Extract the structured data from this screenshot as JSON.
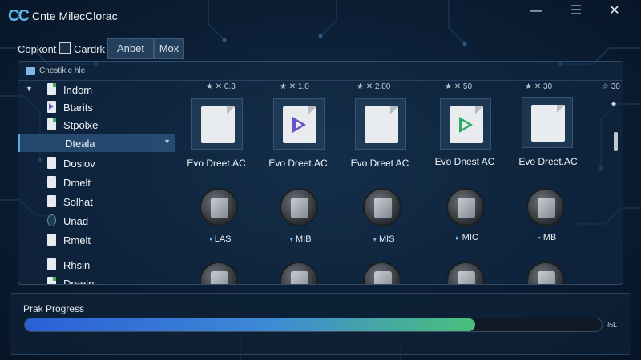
{
  "window": {
    "logo": "CC",
    "title": "Cnte MilecClorac",
    "minimize_icon": "minimize-icon",
    "maximize_icon": "maximize-icon",
    "close_icon": "close-icon"
  },
  "toolbar": {
    "label": "Copkont",
    "checkbox_label": "Cardrk",
    "tabs": [
      "Anbet",
      "Mox"
    ]
  },
  "browser": {
    "title": "Cnestikie hle"
  },
  "sidebar": {
    "items": [
      {
        "label": "Indom",
        "icon": "document-icon"
      },
      {
        "label": "Btarits",
        "icon": "media-file-icon"
      },
      {
        "label": "Stpolxe",
        "icon": "document-icon"
      },
      {
        "label": "Dteala",
        "icon": "document-icon",
        "selected": true
      },
      {
        "label": "Dosiov",
        "icon": "document-icon"
      },
      {
        "label": "Dmelt",
        "icon": "document-icon"
      },
      {
        "label": "Solhat",
        "icon": "document-icon"
      },
      {
        "label": "Unad",
        "icon": "disk-icon"
      },
      {
        "label": "Rmelt",
        "icon": "document-icon"
      },
      {
        "label": "Rhsin",
        "icon": "document-icon"
      },
      {
        "label": "Dreeln",
        "icon": "document-icon"
      }
    ]
  },
  "columns": [
    {
      "rating": "★ ✕ 0.3"
    },
    {
      "rating": "★ ✕ 1.0"
    },
    {
      "rating": "★ ✕ 2.00"
    },
    {
      "rating": "★ ✕ 50"
    },
    {
      "rating": "★ ✕ 30"
    },
    {
      "rating": "☆ 30"
    }
  ],
  "files": [
    {
      "name": "Evo Dreet.AC",
      "type": "document"
    },
    {
      "name": "Evo Dreet.AC",
      "type": "media-purple"
    },
    {
      "name": "Evo Dreet AC",
      "type": "document"
    },
    {
      "name": "Evo Dnest AC",
      "type": "media-green"
    },
    {
      "name": "Evo Dreet.AC",
      "type": "document"
    }
  ],
  "drives": [
    {
      "label": "LAS",
      "marker": "▪"
    },
    {
      "label": "MIB",
      "marker": "▾"
    },
    {
      "label": "MIS",
      "marker": "▾"
    },
    {
      "label": "MIC",
      "marker": "▸"
    },
    {
      "label": "MB",
      "marker": "▪"
    }
  ],
  "progress": {
    "title": "Prak Progress",
    "value_text": "%L",
    "fraction": 0.78
  }
}
